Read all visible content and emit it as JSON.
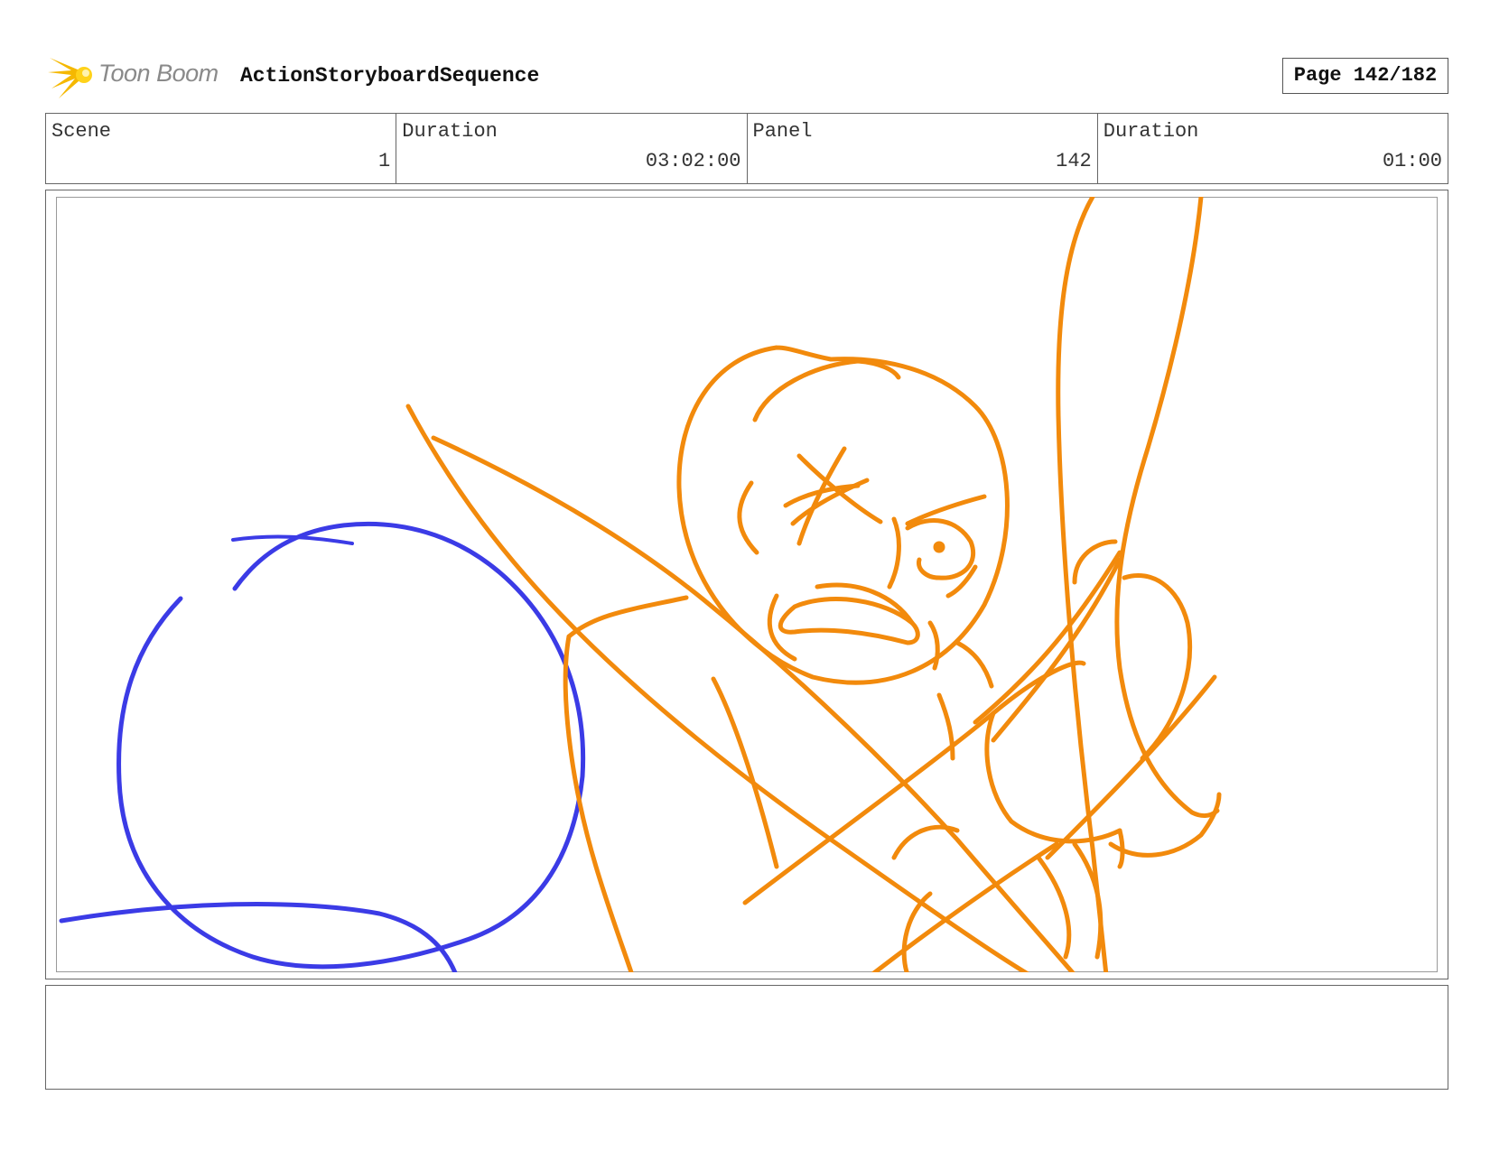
{
  "header": {
    "logo_text": "Toon Boom",
    "project_title": "ActionStoryboardSequence",
    "page_label": "Page 142/182"
  },
  "info": {
    "scene_label": "Scene",
    "scene_value": "1",
    "scene_duration_label": "Duration",
    "scene_duration_value": "03:02:00",
    "panel_label": "Panel",
    "panel_value": "142",
    "panel_duration_label": "Duration",
    "panel_duration_value": "01:00"
  },
  "colors": {
    "logo_accent": "#f5b800",
    "sketch_orange": "#f28a0c",
    "sketch_blue": "#3b3be6"
  },
  "notes": {
    "text": ""
  }
}
